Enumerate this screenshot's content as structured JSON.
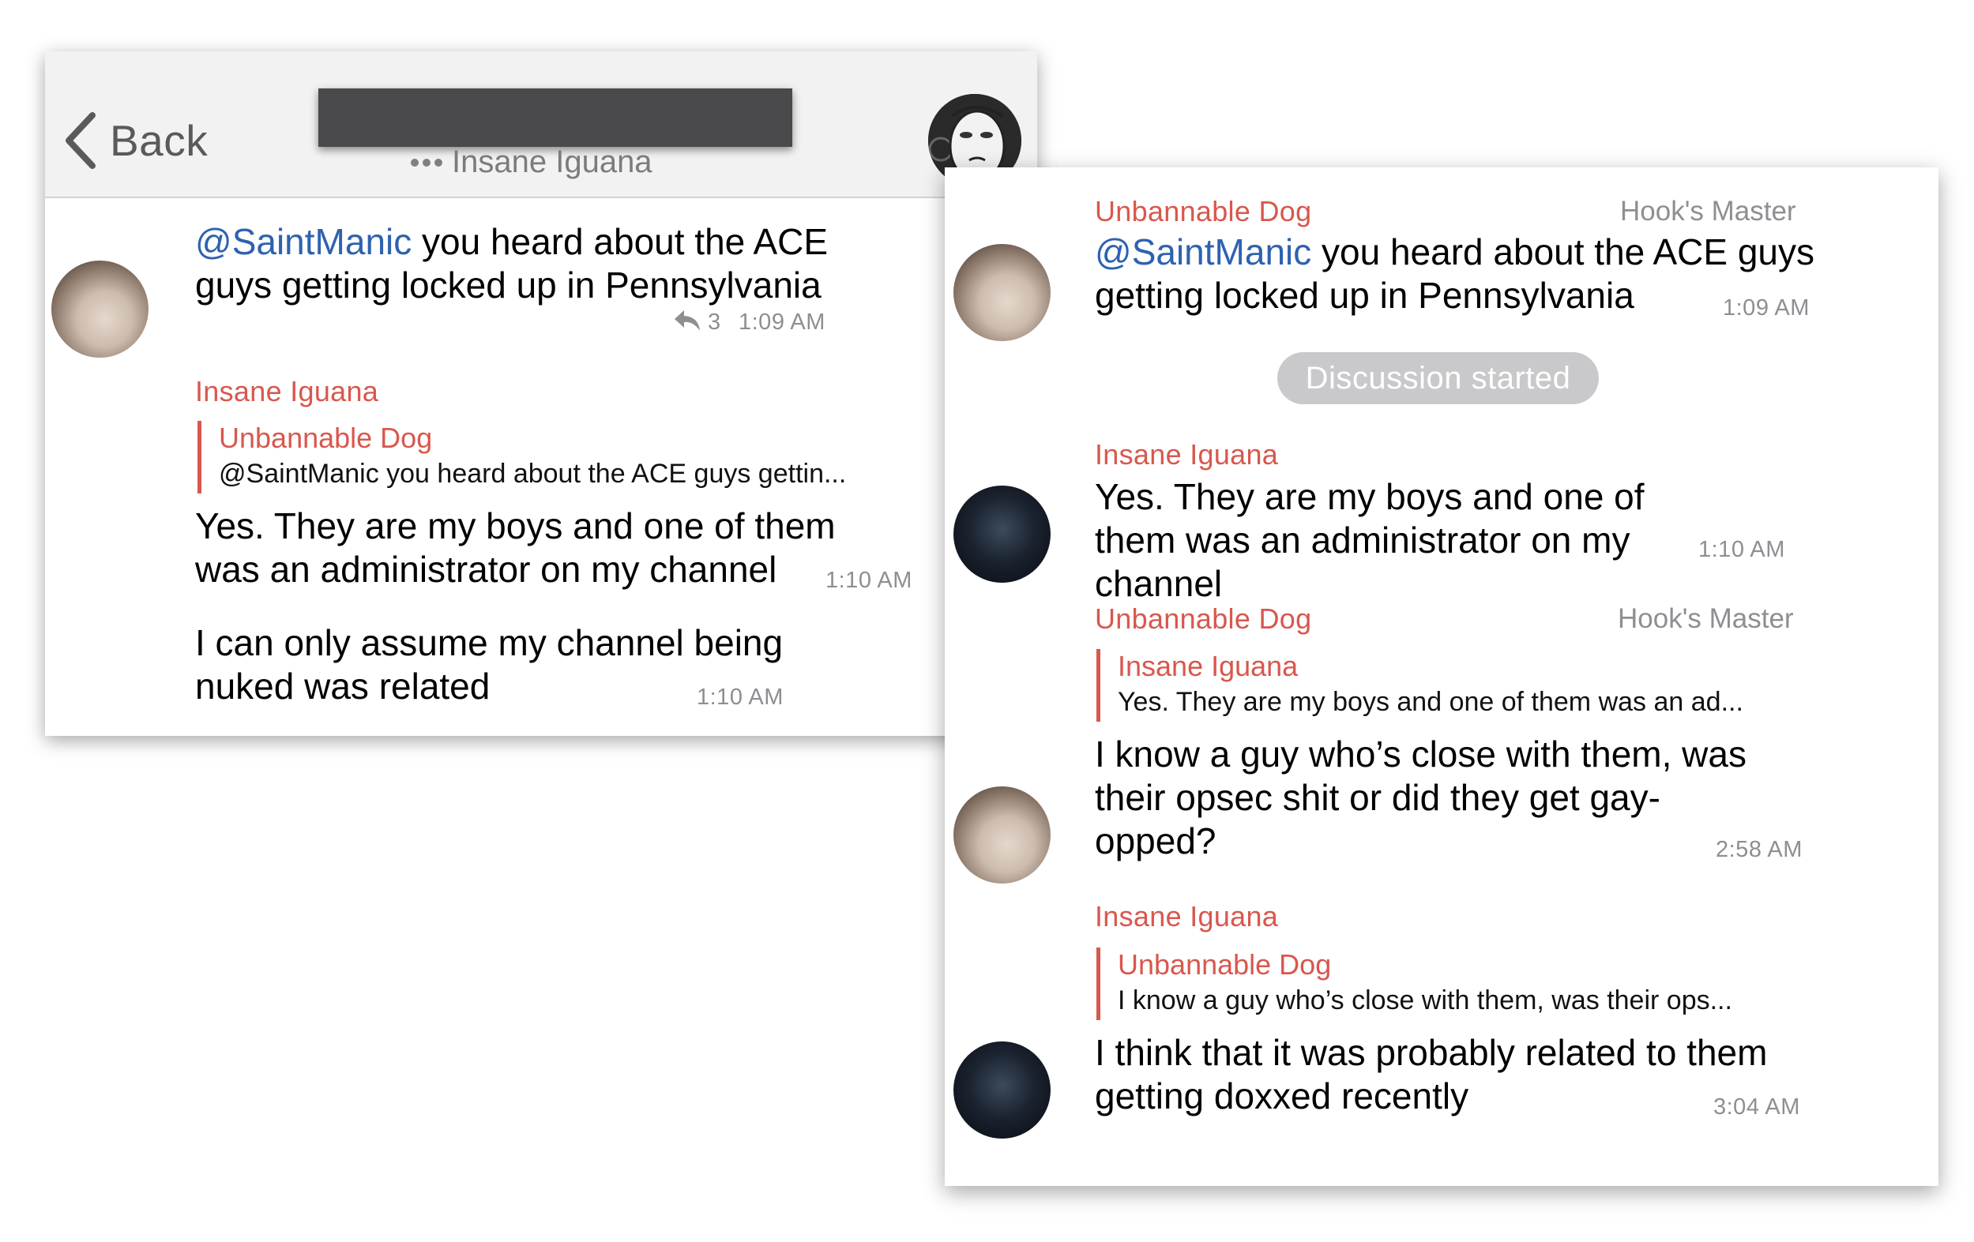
{
  "left_chat": {
    "header": {
      "back_label": "Back",
      "typing_user": "Insane Iguana"
    },
    "messages": [
      {
        "mention": "@SaintManic",
        "text": " you heard about the ACE guys getting locked up in Pennsylvania",
        "reply_count": "3",
        "time": "1:09 AM"
      },
      {
        "sender": "Insane Iguana",
        "quote_sender": "Unbannable Dog",
        "quote_text": "@SaintManic you heard about the ACE guys gettin...",
        "text": "Yes. They are my boys and one of them was an administrator on my channel",
        "time": "1:10 AM"
      },
      {
        "text": "I can only assume my channel being nuked was related",
        "time": "1:10 AM"
      }
    ]
  },
  "right_chat": {
    "service_message": "Discussion started",
    "messages": [
      {
        "sender": "Unbannable Dog",
        "role": "Hook's Master",
        "mention": "@SaintManic",
        "text": " you heard about the ACE guys getting locked up in Pennsylvania",
        "time": "1:09 AM"
      },
      {
        "sender": "Insane Iguana",
        "text": "Yes. They are my boys and one of them was an administrator on my channel",
        "time": "1:10 AM"
      },
      {
        "sender": "Unbannable Dog",
        "role": "Hook's Master",
        "quote_sender": "Insane Iguana",
        "quote_text": "Yes. They are my boys and one of them was an ad...",
        "text": "I know a guy who’s close with them, was their opsec shit or did they get gay-opped?",
        "time": "2:58 AM"
      },
      {
        "sender": "Insane Iguana",
        "quote_sender": "Unbannable Dog",
        "quote_text": "I know a guy who’s close with them, was their ops...",
        "text": "I think that it was probably related to them getting doxxed recently",
        "time": "3:04 AM"
      }
    ]
  },
  "colors": {
    "sender_name": "#d9574d",
    "mention": "#2e62b0",
    "timestamp": "#8e8e93",
    "service_pill": "#c9c9cc",
    "header_bg": "#f2f2f3",
    "redaction": "#4a4a4c"
  },
  "icons": [
    "chevron-left-icon",
    "reply-arrow-icon",
    "typing-dots-icon"
  ]
}
